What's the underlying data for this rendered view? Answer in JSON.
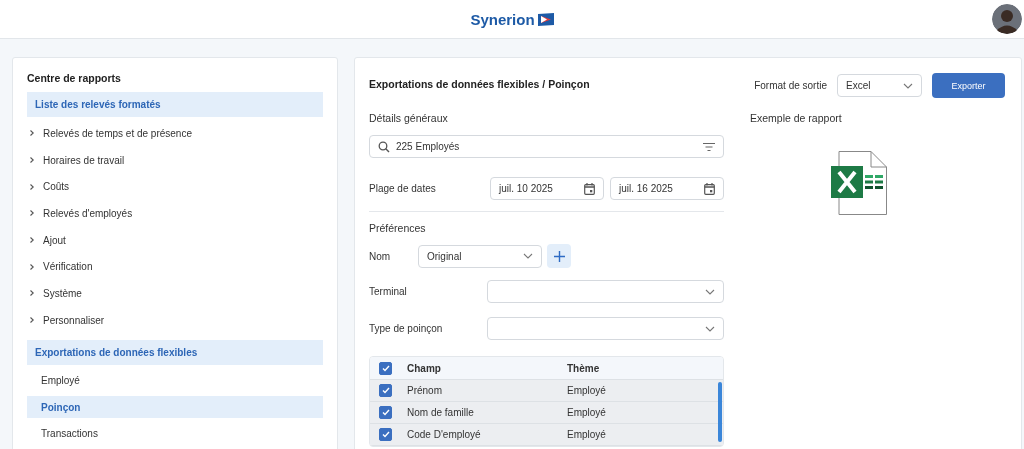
{
  "header": {
    "logo": "Synerion"
  },
  "sidebar": {
    "title": "Centre de rapports",
    "sections": [
      {
        "label": "Liste des relevés formatés",
        "items": [
          {
            "label": "Relevés de temps et de présence",
            "kind": "group",
            "selected": false
          },
          {
            "label": "Horaires de travail",
            "kind": "group",
            "selected": false
          },
          {
            "label": "Coûts",
            "kind": "group",
            "selected": false
          },
          {
            "label": "Relevés d'employés",
            "kind": "group",
            "selected": false
          },
          {
            "label": "Ajout",
            "kind": "group",
            "selected": false
          },
          {
            "label": "Vérification",
            "kind": "group",
            "selected": false
          },
          {
            "label": "Système",
            "kind": "group",
            "selected": false
          },
          {
            "label": "Personnaliser",
            "kind": "group",
            "selected": false
          }
        ]
      },
      {
        "label": "Exportations de données flexibles",
        "items": [
          {
            "label": "Employé",
            "kind": "leaf",
            "selected": false
          },
          {
            "label": "Poinçon",
            "kind": "leaf",
            "selected": true
          },
          {
            "label": "Transactions",
            "kind": "leaf",
            "selected": false
          }
        ]
      }
    ]
  },
  "main": {
    "title": "Exportations de données flexibles / Poinçon",
    "output_format": {
      "label": "Format de sortie",
      "value": "Excel"
    },
    "export_button": "Exporter",
    "general": {
      "heading": "Détails généraux",
      "search": {
        "value": "225 Employés"
      },
      "date_range": {
        "label": "Plage de dates",
        "start": "juil. 10 2025",
        "end": "juil. 16 2025"
      }
    },
    "preferences": {
      "heading": "Préférences",
      "name": {
        "label": "Nom",
        "value": "Original"
      },
      "terminal": {
        "label": "Terminal"
      },
      "punch_type": {
        "label": "Type de poinçon"
      }
    },
    "table": {
      "columns": [
        "Champ",
        "Thème"
      ],
      "header_checked": true,
      "rows": [
        {
          "field": "Prénom",
          "theme": "Employé",
          "checked": true
        },
        {
          "field": "Nom de famille",
          "theme": "Employé",
          "checked": true
        },
        {
          "field": "Code D'employé",
          "theme": "Employé",
          "checked": true
        }
      ]
    },
    "preview": {
      "heading": "Exemple de rapport"
    }
  }
}
